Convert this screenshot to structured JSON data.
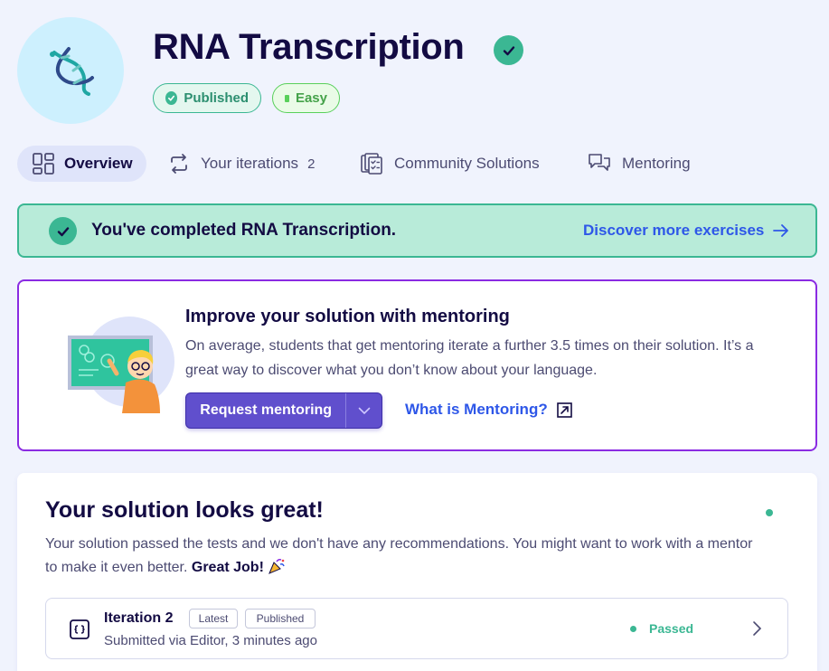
{
  "exercise": {
    "title": "RNA Transcription",
    "icon": "dna-helix-icon",
    "badges": {
      "published": "Published",
      "difficulty": "Easy"
    }
  },
  "tabs": {
    "overview": "Overview",
    "iterations": "Your iterations",
    "iterations_count": "2",
    "community": "Community Solutions",
    "mentoring": "Mentoring"
  },
  "completed_banner": {
    "message": "You've completed RNA Transcription.",
    "link": "Discover more exercises"
  },
  "mentoring_card": {
    "title": "Improve your solution with mentoring",
    "description": "On average, students that get mentoring iterate a further 3.5 times on their solution. It’s a great way to discover what you don’t know about your language.",
    "button": "Request mentoring",
    "link": "What is Mentoring?"
  },
  "solution_card": {
    "title": "Your solution looks great!",
    "description": "Your solution passed the tests and we don't have any recommendations. You might want to work with a mentor to make it even better.",
    "emphasis": "Great Job!",
    "iteration": {
      "name": "Iteration 2",
      "tags": [
        "Latest",
        "Published"
      ],
      "submitted": "Submitted via Editor, 3 minutes ago",
      "status": "Passed"
    }
  },
  "colors": {
    "accent": "#604fcd",
    "success": "#3bb793",
    "link": "#2e57e8",
    "mentoring_border": "#8a2be2",
    "easy": "#59d05b"
  }
}
